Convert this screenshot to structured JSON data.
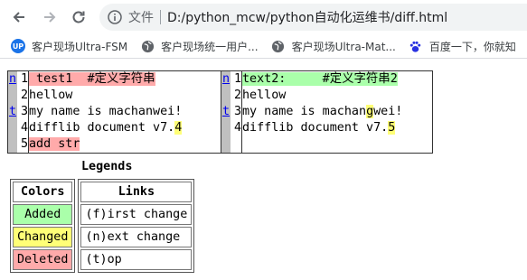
{
  "browser": {
    "scheme_label": "文件",
    "url": "D:/python_mcw/python自动化运维书/diff.html",
    "bookmarks": [
      {
        "icon": "up-logo-icon",
        "label": "客户现场Ultra-FSM"
      },
      {
        "icon": "globe-icon",
        "label": "客户现场统一用户..."
      },
      {
        "icon": "globe-icon",
        "label": "客户现场Ultra-Mat..."
      },
      {
        "icon": "baidu-paw-icon",
        "label": "百度一下，你就知"
      }
    ]
  },
  "diff": {
    "nav_links": {
      "first": "n",
      "next1": "n",
      "top": "t",
      "next2": "n",
      "top2": "t"
    },
    "left_rows": [
      {
        "no": "1",
        "pre": "",
        "del": " test1  #定义字符串",
        "post": ""
      },
      {
        "no": "2",
        "text": "hellow"
      },
      {
        "no": "3",
        "text": "my name is machanwei!"
      },
      {
        "no": "4",
        "pre": "difflib document v7.",
        "chg": "4",
        "post": ""
      },
      {
        "no": "5",
        "del": "add str"
      }
    ],
    "right_rows": [
      {
        "no": "1",
        "add": "text2:     #定义字符串2"
      },
      {
        "no": "2",
        "text": "hellow"
      },
      {
        "no": "3",
        "pre": "my name is machan",
        "chg": "g",
        "post": "wei!"
      },
      {
        "no": "4",
        "pre": "difflib document v7.",
        "chg": "5",
        "post": ""
      },
      {
        "no": "",
        "text": ""
      }
    ]
  },
  "legend": {
    "title": "Legends",
    "colors_header": "Colors",
    "links_header": "Links",
    "colors": [
      "Added",
      "Changed",
      "Deleted"
    ],
    "links": [
      "(f)irst change",
      "(n)ext change",
      "(t)op"
    ],
    "color_values": {
      "added": "#aaffaa",
      "changed": "#ffff77",
      "deleted": "#ffaaaa"
    }
  }
}
